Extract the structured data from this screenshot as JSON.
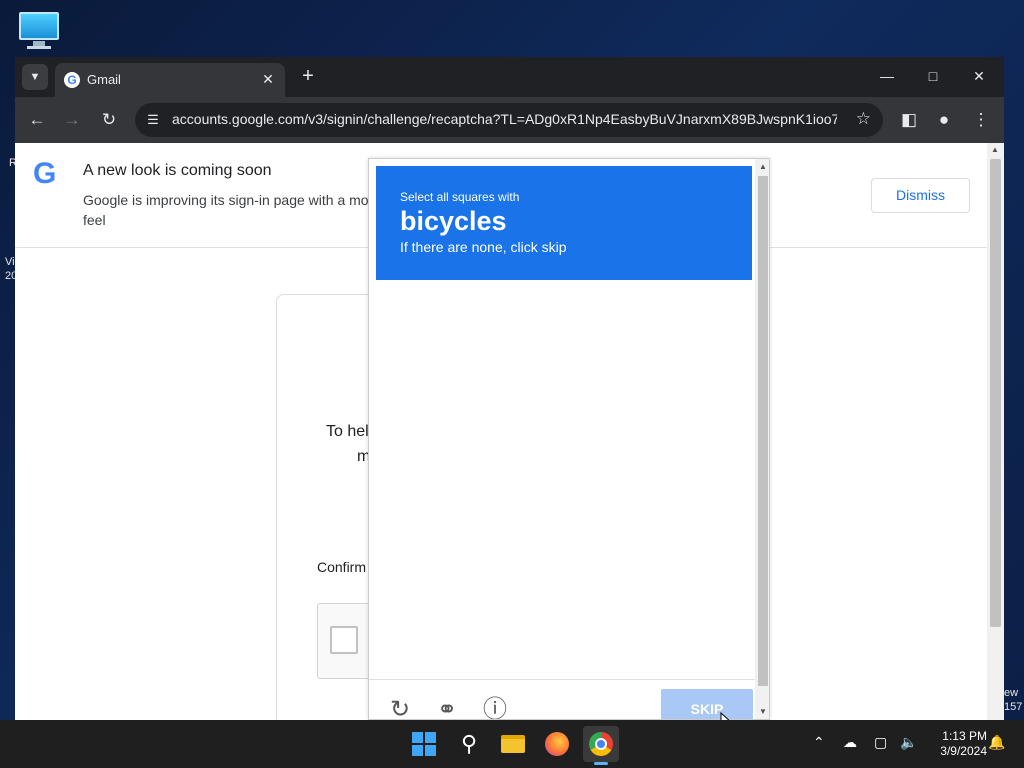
{
  "desktop": {
    "icon": "computer-monitor-icon",
    "edge_labels": [
      "R",
      "Vi",
      "20",
      "ew",
      "157"
    ]
  },
  "browser": {
    "tab": {
      "title": "Gmail",
      "favicon": "google-g-icon",
      "close_label": "✕"
    },
    "new_tab_label": "+",
    "url": "accounts.google.com/v3/signin/challenge/recaptcha?TL=ADg0xR1Np4EasbyBuVJnarxmX89BJwspnK1ioo7..."
  },
  "banner": {
    "title": "A new look is coming soon",
    "body": "Google is improving its sign-in page with a mo",
    "body_line2": "feel",
    "dismiss_label": "Dismiss"
  },
  "card": {
    "line1": "To hel",
    "line2": "m",
    "confirm": "Confirm"
  },
  "challenge": {
    "instruction": "Select all squares with",
    "target": "bicycles",
    "hint": "If there are none, click skip",
    "skip_label": "SKIP",
    "icons": [
      "reload-icon",
      "audio-headphones-icon",
      "info-icon"
    ],
    "header_color": "#1a73e8"
  },
  "taskbar": {
    "apps": [
      "windows-start-icon",
      "search-icon",
      "file-explorer-icon",
      "firefox-icon",
      "chrome-icon"
    ],
    "time": "1:13 PM",
    "date": "3/9/2024"
  }
}
